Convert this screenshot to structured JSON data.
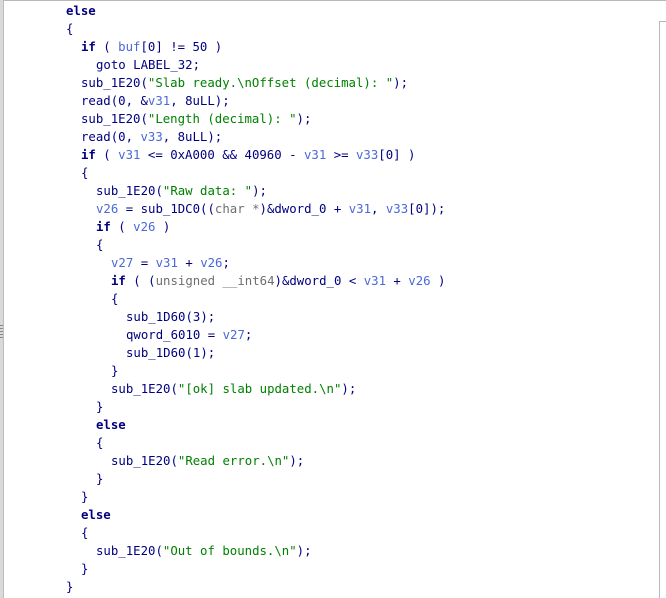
{
  "window": {
    "content_type": "decompiled pseudocode"
  },
  "code": [
    {
      "indent": 4,
      "tokens": [
        {
          "text": "else",
          "type": "kw"
        }
      ]
    },
    {
      "indent": 4,
      "tokens": [
        {
          "text": "{",
          "type": "txt"
        }
      ]
    },
    {
      "indent": 5,
      "tokens": [
        {
          "text": "if",
          "type": "kw"
        },
        {
          "text": " ( ",
          "type": "txt"
        },
        {
          "text": "buf",
          "type": "var"
        },
        {
          "text": "[0] != 50 )",
          "type": "txt"
        }
      ]
    },
    {
      "indent": 6,
      "tokens": [
        {
          "text": "goto",
          "type": "txt"
        },
        {
          "text": " LABEL_32;",
          "type": "txt"
        }
      ]
    },
    {
      "indent": 5,
      "tokens": [
        {
          "text": "sub_1E20",
          "type": "fn"
        },
        {
          "text": "(",
          "type": "txt"
        },
        {
          "text": "\"Slab ready.\\nOffset (decimal): \"",
          "type": "str"
        },
        {
          "text": ");",
          "type": "txt"
        }
      ]
    },
    {
      "indent": 5,
      "tokens": [
        {
          "text": "read",
          "type": "fn"
        },
        {
          "text": "(0, &",
          "type": "txt"
        },
        {
          "text": "v31",
          "type": "var"
        },
        {
          "text": ", 8uLL);",
          "type": "txt"
        }
      ]
    },
    {
      "indent": 5,
      "tokens": [
        {
          "text": "sub_1E20",
          "type": "fn"
        },
        {
          "text": "(",
          "type": "txt"
        },
        {
          "text": "\"Length (decimal): \"",
          "type": "str"
        },
        {
          "text": ");",
          "type": "txt"
        }
      ]
    },
    {
      "indent": 5,
      "tokens": [
        {
          "text": "read",
          "type": "fn"
        },
        {
          "text": "(0, ",
          "type": "txt"
        },
        {
          "text": "v33",
          "type": "var"
        },
        {
          "text": ", 8uLL);",
          "type": "txt"
        }
      ]
    },
    {
      "indent": 5,
      "tokens": [
        {
          "text": "if",
          "type": "kw"
        },
        {
          "text": " ( ",
          "type": "txt"
        },
        {
          "text": "v31",
          "type": "var"
        },
        {
          "text": " <= 0xA000 && 40960 - ",
          "type": "txt"
        },
        {
          "text": "v31",
          "type": "var"
        },
        {
          "text": " >= ",
          "type": "txt"
        },
        {
          "text": "v33",
          "type": "var"
        },
        {
          "text": "[0] )",
          "type": "txt"
        }
      ]
    },
    {
      "indent": 5,
      "tokens": [
        {
          "text": "{",
          "type": "txt"
        }
      ]
    },
    {
      "indent": 6,
      "tokens": [
        {
          "text": "sub_1E20",
          "type": "fn"
        },
        {
          "text": "(",
          "type": "txt"
        },
        {
          "text": "\"Raw data: \"",
          "type": "str"
        },
        {
          "text": ");",
          "type": "txt"
        }
      ]
    },
    {
      "indent": 6,
      "tokens": [
        {
          "text": "v26",
          "type": "var"
        },
        {
          "text": " = ",
          "type": "txt"
        },
        {
          "text": "sub_1DC0",
          "type": "fn"
        },
        {
          "text": "((",
          "type": "txt"
        },
        {
          "text": "char *",
          "type": "type"
        },
        {
          "text": ")&dword_0 + ",
          "type": "txt"
        },
        {
          "text": "v31",
          "type": "var"
        },
        {
          "text": ", ",
          "type": "txt"
        },
        {
          "text": "v33",
          "type": "var"
        },
        {
          "text": "[0]);",
          "type": "txt"
        }
      ]
    },
    {
      "indent": 6,
      "tokens": [
        {
          "text": "if",
          "type": "kw"
        },
        {
          "text": " ( ",
          "type": "txt"
        },
        {
          "text": "v26",
          "type": "var"
        },
        {
          "text": " )",
          "type": "txt"
        }
      ]
    },
    {
      "indent": 6,
      "tokens": [
        {
          "text": "{",
          "type": "txt"
        }
      ]
    },
    {
      "indent": 7,
      "tokens": [
        {
          "text": "v27",
          "type": "var"
        },
        {
          "text": " = ",
          "type": "txt"
        },
        {
          "text": "v31",
          "type": "var"
        },
        {
          "text": " + ",
          "type": "txt"
        },
        {
          "text": "v26",
          "type": "var"
        },
        {
          "text": ";",
          "type": "txt"
        }
      ]
    },
    {
      "indent": 7,
      "tokens": [
        {
          "text": "if",
          "type": "kw"
        },
        {
          "text": " ( (",
          "type": "txt"
        },
        {
          "text": "unsigned __int64",
          "type": "type"
        },
        {
          "text": ")&dword_0 < ",
          "type": "txt"
        },
        {
          "text": "v31",
          "type": "var"
        },
        {
          "text": " + ",
          "type": "txt"
        },
        {
          "text": "v26",
          "type": "var"
        },
        {
          "text": " )",
          "type": "txt"
        }
      ]
    },
    {
      "indent": 7,
      "tokens": [
        {
          "text": "{",
          "type": "txt"
        }
      ]
    },
    {
      "indent": 8,
      "tokens": [
        {
          "text": "sub_1D60",
          "type": "fn"
        },
        {
          "text": "(3);",
          "type": "txt"
        }
      ]
    },
    {
      "indent": 8,
      "tokens": [
        {
          "text": "qword_6010 = ",
          "type": "txt"
        },
        {
          "text": "v27",
          "type": "var"
        },
        {
          "text": ";",
          "type": "txt"
        }
      ]
    },
    {
      "indent": 8,
      "tokens": [
        {
          "text": "sub_1D60",
          "type": "fn"
        },
        {
          "text": "(1);",
          "type": "txt"
        }
      ]
    },
    {
      "indent": 7,
      "tokens": [
        {
          "text": "}",
          "type": "txt"
        }
      ]
    },
    {
      "indent": 7,
      "tokens": [
        {
          "text": "sub_1E20",
          "type": "fn"
        },
        {
          "text": "(",
          "type": "txt"
        },
        {
          "text": "\"[ok] slab updated.\\n\"",
          "type": "str"
        },
        {
          "text": ");",
          "type": "txt"
        }
      ]
    },
    {
      "indent": 6,
      "tokens": [
        {
          "text": "}",
          "type": "txt"
        }
      ]
    },
    {
      "indent": 6,
      "tokens": [
        {
          "text": "else",
          "type": "kw"
        }
      ]
    },
    {
      "indent": 6,
      "tokens": [
        {
          "text": "{",
          "type": "txt"
        }
      ]
    },
    {
      "indent": 7,
      "tokens": [
        {
          "text": "sub_1E20",
          "type": "fn"
        },
        {
          "text": "(",
          "type": "txt"
        },
        {
          "text": "\"Read error.\\n\"",
          "type": "str"
        },
        {
          "text": ");",
          "type": "txt"
        }
      ]
    },
    {
      "indent": 6,
      "tokens": [
        {
          "text": "}",
          "type": "txt"
        }
      ]
    },
    {
      "indent": 5,
      "tokens": [
        {
          "text": "}",
          "type": "txt"
        }
      ]
    },
    {
      "indent": 5,
      "tokens": [
        {
          "text": "else",
          "type": "kw"
        }
      ]
    },
    {
      "indent": 5,
      "tokens": [
        {
          "text": "{",
          "type": "txt"
        }
      ]
    },
    {
      "indent": 6,
      "tokens": [
        {
          "text": "sub_1E20",
          "type": "fn"
        },
        {
          "text": "(",
          "type": "txt"
        },
        {
          "text": "\"Out of bounds.\\n\"",
          "type": "str"
        },
        {
          "text": ");",
          "type": "txt"
        }
      ]
    },
    {
      "indent": 5,
      "tokens": [
        {
          "text": "}",
          "type": "txt"
        }
      ]
    },
    {
      "indent": 4,
      "tokens": [
        {
          "text": "}",
          "type": "txt"
        }
      ]
    }
  ],
  "colors": {
    "background": "#ffffff",
    "default_text": "#000080",
    "variable": "#4b68d8",
    "string": "#008000",
    "type": "#6f6f6f",
    "divider": "#b8b8b8"
  }
}
